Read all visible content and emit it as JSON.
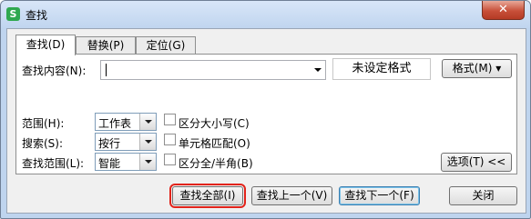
{
  "window": {
    "title": "查找",
    "app_icon_letter": "S",
    "close_symbol": "✕"
  },
  "tabs": [
    {
      "label": "查找(D)",
      "active": true
    },
    {
      "label": "替换(P)",
      "active": false
    },
    {
      "label": "定位(G)",
      "active": false
    }
  ],
  "find": {
    "label": "查找内容(N):",
    "value": "",
    "format_preview": "未设定格式",
    "format_button": "格式(M) ▾"
  },
  "options": [
    {
      "label": "范围(H):",
      "value": "工作表",
      "checkbox_label": "区分大小写(C)",
      "checked": false
    },
    {
      "label": "搜索(S):",
      "value": "按行",
      "checkbox_label": "单元格匹配(O)",
      "checked": false
    },
    {
      "label": "查找范围(L):",
      "value": "智能",
      "checkbox_label": "区分全/半角(B)",
      "checked": false
    }
  ],
  "options_button": "选项(T) <<",
  "buttons": {
    "find_all": "查找全部(I)",
    "find_prev": "查找上一个(V)",
    "find_next": "查找下一个(F)",
    "close": "关闭"
  }
}
